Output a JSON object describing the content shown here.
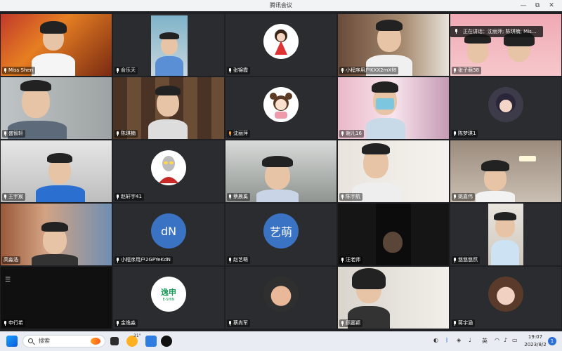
{
  "window": {
    "title": "腾讯会议",
    "controls": {
      "minimize": "—",
      "restore": "⧉",
      "close": "✕"
    }
  },
  "speaking_banner": "正在讲话：沈丽萍; 陈琪楠; Mis...",
  "participants": [
    {
      "name": "Miss Shen",
      "kind": "video"
    },
    {
      "name": "俞乐天",
      "kind": "video"
    },
    {
      "name": "张锦霞",
      "kind": "avatar"
    },
    {
      "name": "小程序用户KXX2mXf8",
      "kind": "video"
    },
    {
      "name": "张子萌38",
      "kind": "video"
    },
    {
      "name": "盛智轩",
      "kind": "video"
    },
    {
      "name": "陈琪楠",
      "kind": "video"
    },
    {
      "name": "沈丽萍",
      "kind": "avatar"
    },
    {
      "name": "谢儿16",
      "kind": "video"
    },
    {
      "name": "陈梦琪1",
      "kind": "avatar"
    },
    {
      "name": "王宇宸",
      "kind": "video"
    },
    {
      "name": "赵轩宇41",
      "kind": "avatar"
    },
    {
      "name": "蔡晨奚",
      "kind": "video"
    },
    {
      "name": "陈宇航",
      "kind": "video"
    },
    {
      "name": "姚嘉伟",
      "kind": "video"
    },
    {
      "name": "高淼浩",
      "kind": "video"
    },
    {
      "name": "小程序用户2GPYeKdN",
      "kind": "avatar",
      "initials": "dN"
    },
    {
      "name": "赵艺萌",
      "kind": "avatar",
      "initials": "艺萌"
    },
    {
      "name": "汪老师",
      "kind": "video"
    },
    {
      "name": "悠悠悠然",
      "kind": "video"
    },
    {
      "name": "申行希",
      "kind": "video"
    },
    {
      "name": "金逸淼",
      "kind": "avatar",
      "logo_text": "逸申",
      "logo_sub": "E-SHIN"
    },
    {
      "name": "蔡尚军",
      "kind": "avatar"
    },
    {
      "name": "顾嘉颖",
      "kind": "video"
    },
    {
      "name": "蒋宇涵",
      "kind": "avatar"
    }
  ],
  "taskbar": {
    "search_label": "搜索",
    "weather_temp": "31°",
    "ime": "英",
    "time": "19:07",
    "date": "2023/8/2",
    "notification_count": "1"
  },
  "colors": {
    "dn_avatar": "#3b73c4",
    "yimeng_avatar": "#3b73c4",
    "speaker_mic": "#ff9a2e"
  }
}
